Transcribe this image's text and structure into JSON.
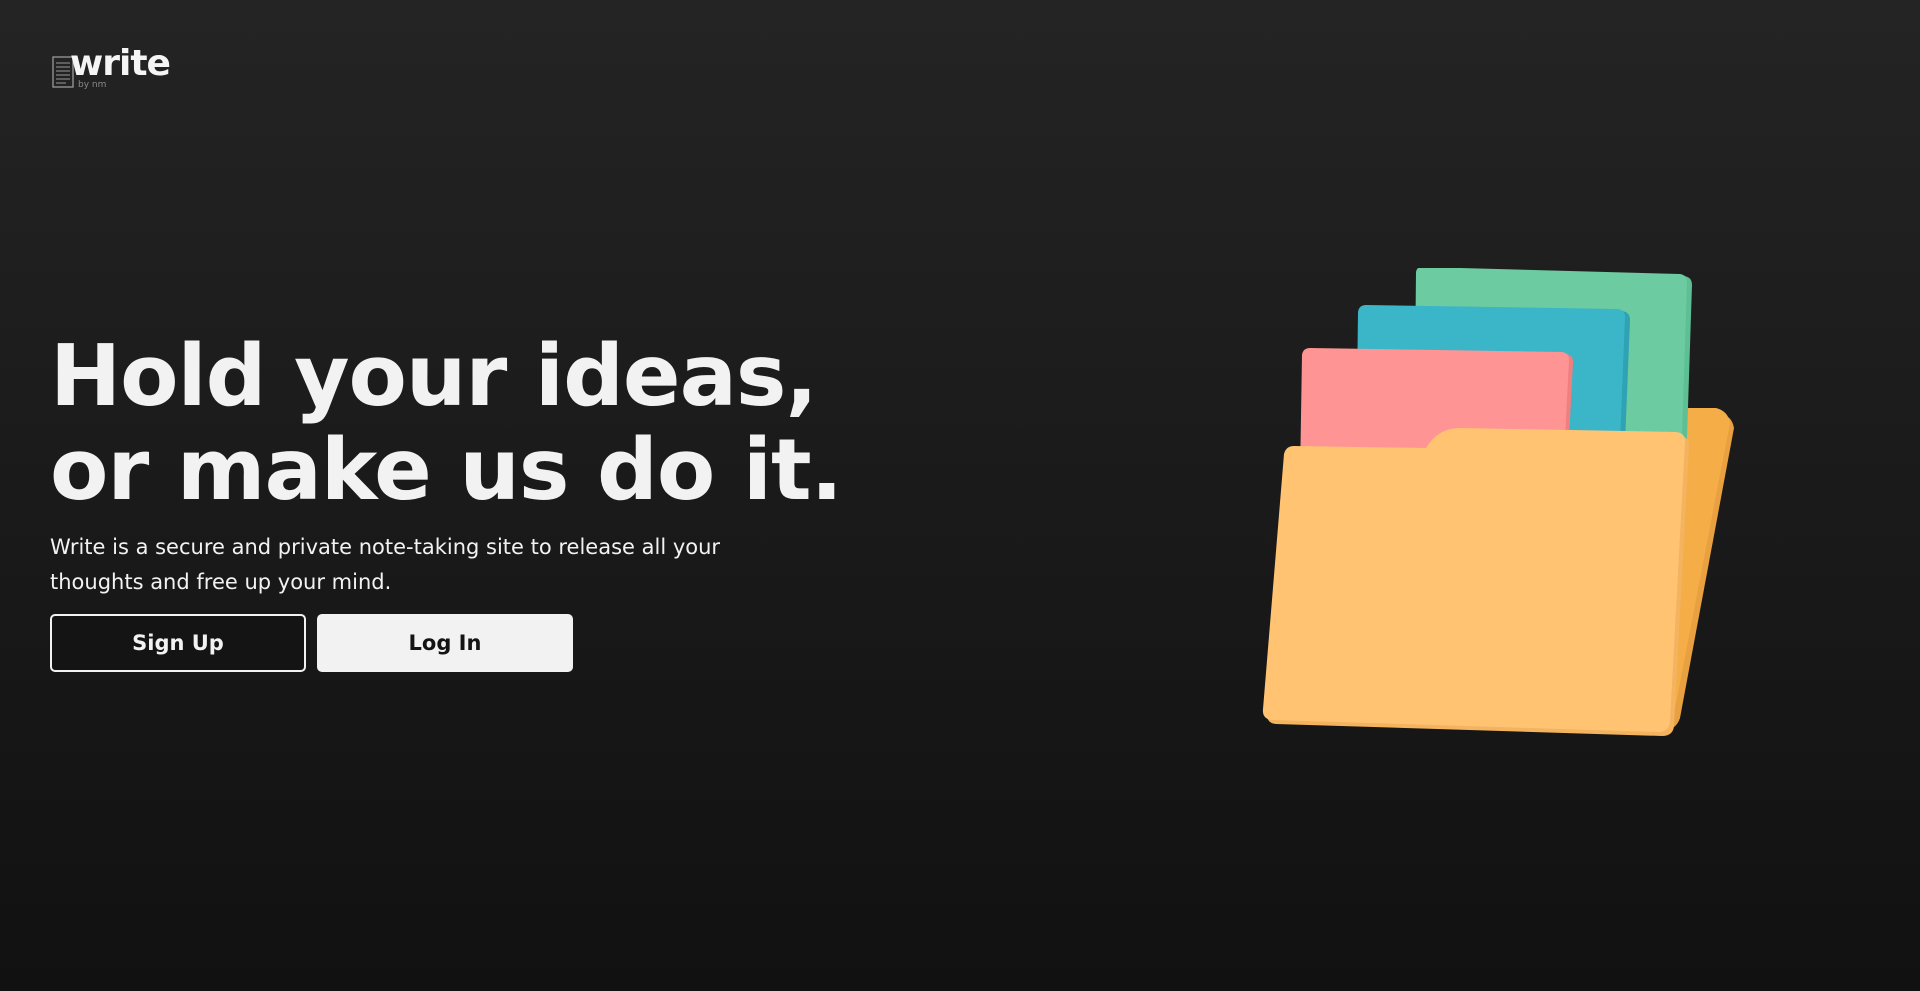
{
  "brand": {
    "name": "write",
    "tagline": "by nm"
  },
  "hero": {
    "headline_line1": "Hold your ideas,",
    "headline_line2": "or make us do it.",
    "subtitle": "Write is a secure and private note-taking site to release all your thoughts and free up your mind."
  },
  "actions": {
    "signup_label": "Sign Up",
    "login_label": "Log In"
  },
  "colors": {
    "background_top": "#242424",
    "background_bottom": "#111111",
    "text": "#f2f2f2",
    "folder": "#ffc372",
    "folder_back": "#f5ad48",
    "paper_green": "#6ccba0",
    "paper_blue": "#3bb5c8",
    "paper_pink": "#ff9494"
  },
  "icons": {
    "logo": "document-icon",
    "illustration": "folder-with-papers-icon"
  }
}
